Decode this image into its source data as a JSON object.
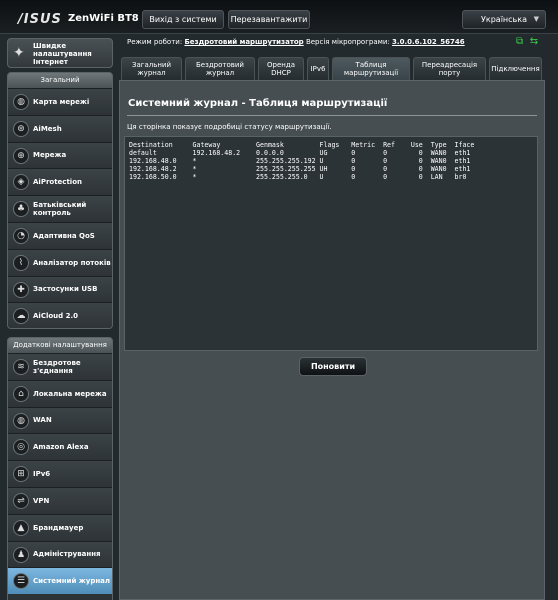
{
  "header": {
    "brand": "/ISUS",
    "model": "ZenWiFi BT8",
    "logout_label": "Вихід з системи",
    "reboot_label": "Перезавантажити",
    "language": "Українська"
  },
  "status": {
    "mode_label": "Режим роботи:",
    "mode_value": "Бездротовий маршрутизатор",
    "firmware_label": "Версія мікропрограми:",
    "firmware_value": "3.0.0.6.102_56746"
  },
  "sidebar": {
    "quick_label": "Швидке налаштування Інтернет",
    "general_header": "Загальний",
    "general_items": [
      {
        "label": "Карта мережі",
        "icon": "globe-icon"
      },
      {
        "label": "AiMesh",
        "icon": "aimesh-icon"
      },
      {
        "label": "Мережа",
        "icon": "network-icon"
      },
      {
        "label": "AiProtection",
        "icon": "shield-icon"
      },
      {
        "label": "Батьківський контроль",
        "icon": "family-icon"
      },
      {
        "label": "Адаптивна QoS",
        "icon": "gauge-icon"
      },
      {
        "label": "Аналізатор потоків",
        "icon": "chart-icon"
      },
      {
        "label": "Застосунки USB",
        "icon": "puzzle-icon"
      },
      {
        "label": "AiCloud 2.0",
        "icon": "cloud-icon"
      }
    ],
    "advanced_header": "Додаткові налаштування",
    "advanced_items": [
      {
        "label": "Бездротове з'єднання",
        "icon": "wifi-icon"
      },
      {
        "label": "Локальна мережа",
        "icon": "home-icon"
      },
      {
        "label": "WAN",
        "icon": "wan-globe-icon"
      },
      {
        "label": "Amazon Alexa",
        "icon": "alexa-icon"
      },
      {
        "label": "IPv6",
        "icon": "ipv6-icon"
      },
      {
        "label": "VPN",
        "icon": "vpn-icon"
      },
      {
        "label": "Брандмауер",
        "icon": "firewall-icon"
      },
      {
        "label": "Адміністрування",
        "icon": "admin-icon"
      },
      {
        "label": "Системний журнал",
        "icon": "log-icon"
      }
    ]
  },
  "tabs": [
    {
      "label": "Загальний журнал"
    },
    {
      "label": "Бездротовий журнал"
    },
    {
      "label": "Оренда DHCP"
    },
    {
      "label": "IPv6"
    },
    {
      "label": "Таблиця маршрутизації"
    },
    {
      "label": "Переадресація порту"
    },
    {
      "label": "Підключення"
    }
  ],
  "main": {
    "title": "Системний журнал - Таблиця маршрутизації",
    "description": "Ця сторінка показує подробиці статусу маршрутизації.",
    "routing_table": "Destination     Gateway         Genmask         Flags   Metric  Ref    Use  Type  Iface\ndefault         192.168.48.2    0.0.0.0         UG      0       0        0  WAN0  eth1\n192.168.48.0    *               255.255.255.192 U       0       0        0  WAN0  eth1\n192.168.48.2    *               255.255.255.255 UH      0       0        0  WAN0  eth1\n192.168.50.0    *               255.255.255.0   U       0       0        0  LAN   br0",
    "refresh_label": "Поновити"
  }
}
